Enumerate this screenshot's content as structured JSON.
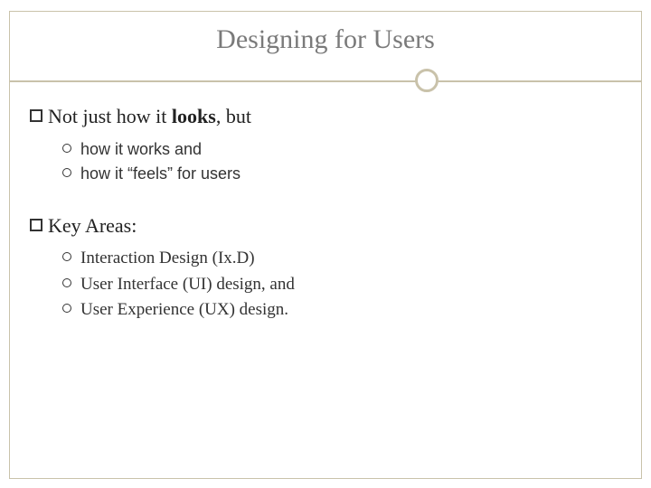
{
  "title": "Designing for Users",
  "section1": {
    "heading_pre": "Not just how it ",
    "heading_bold": "looks",
    "heading_post": ", but",
    "items": [
      "how it works and",
      "how it “feels” for users"
    ]
  },
  "section2": {
    "heading": "Key Areas:",
    "items": [
      "Interaction Design (Ix.D)",
      "User Interface (UI) design, and",
      "User Experience (UX) design."
    ]
  }
}
